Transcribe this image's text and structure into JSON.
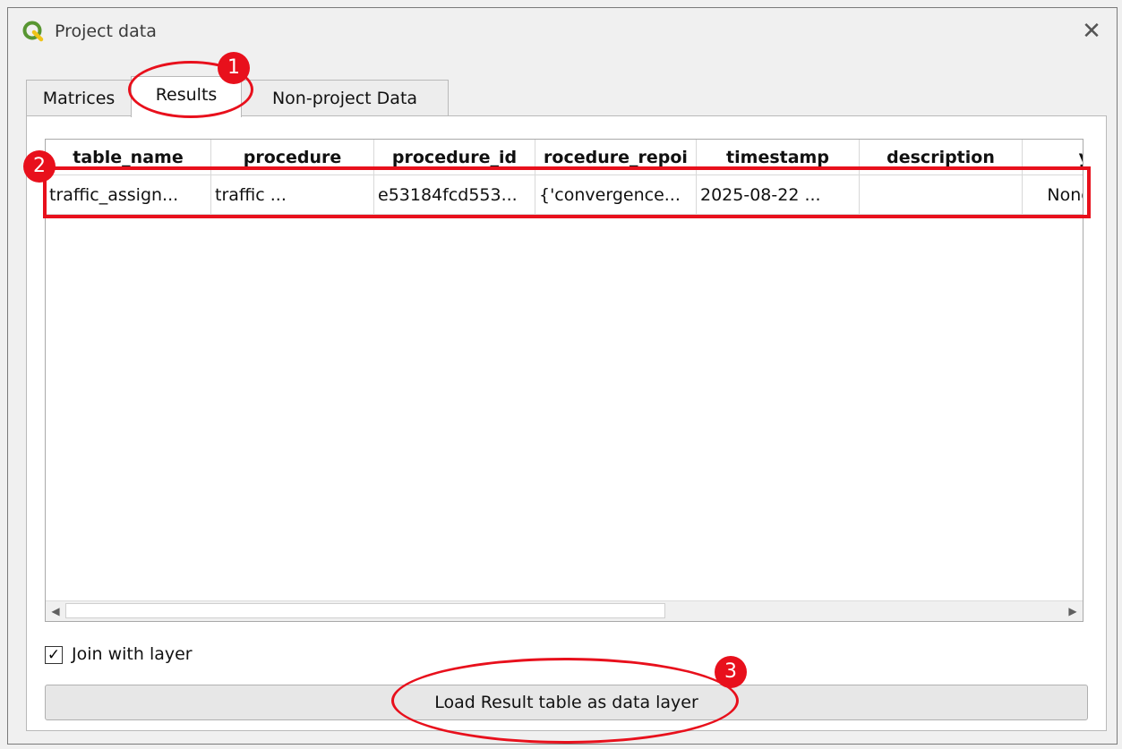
{
  "window": {
    "title": "Project data",
    "close_glyph": "✕",
    "logo_icon": "qgis-logo-icon"
  },
  "tabs": [
    {
      "label": "Matrices"
    },
    {
      "label": "Results"
    },
    {
      "label": "Non-project Data"
    }
  ],
  "table": {
    "columns": [
      "table_name",
      "procedure",
      "procedure_id",
      "rocedure_repoi",
      "timestamp",
      "description",
      "y"
    ],
    "rows": [
      [
        "traffic_assign...",
        "traffic ...",
        "e53184fcd553...",
        "{'convergence...",
        "2025-08-22 ...",
        "",
        "None"
      ]
    ],
    "scroll_left_glyph": "◀",
    "scroll_right_glyph": "▶"
  },
  "options": {
    "join_label": "Join with layer",
    "join_checked": true,
    "check_glyph": "✓"
  },
  "actions": {
    "load_label": "Load Result table as data layer"
  },
  "annotations": {
    "badges": [
      "1",
      "2",
      "3"
    ],
    "color": "#e8101c"
  },
  "colors": {
    "accent": "#e8101c",
    "logo_green": "#589632",
    "logo_yellow": "#f0c419"
  }
}
